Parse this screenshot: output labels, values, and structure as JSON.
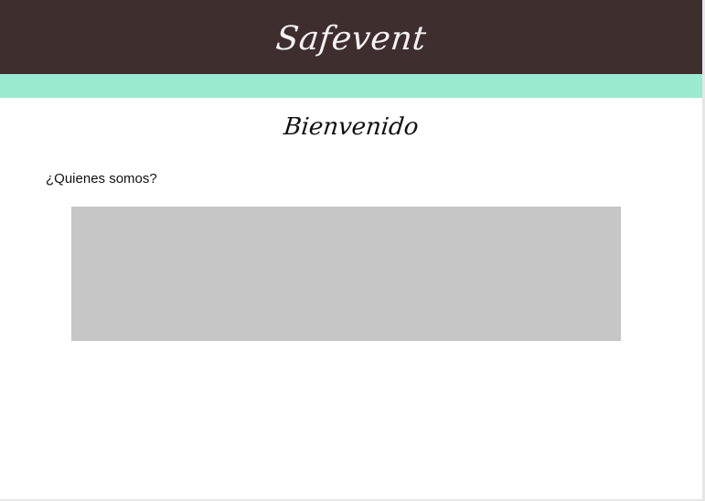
{
  "header": {
    "brand": "Safevent"
  },
  "main": {
    "welcome_title": "Bienvenido",
    "about_heading": "¿Quienes somos?"
  },
  "colors": {
    "header_bg": "#3f2e2e",
    "accent_band": "#9aead0",
    "placeholder": "#c6c6c6",
    "page_bg": "#ffffff"
  }
}
